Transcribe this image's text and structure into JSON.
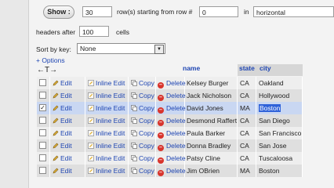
{
  "controls": {
    "show_label": "Show :",
    "rows_value": "30",
    "rows_text": "row(s) starting from row #",
    "start_value": "0",
    "in_text": "in",
    "mode_value": "horizontal",
    "headers_after_label": "headers after",
    "headers_after_value": "100",
    "cells_label": "cells",
    "sort_label": "Sort by key:",
    "sort_value": "None",
    "options_link": "+ Options",
    "arrows": "←T→"
  },
  "table": {
    "headers": {
      "name": "name",
      "state": "state",
      "city": "city"
    },
    "actions": {
      "edit": "Edit",
      "inline_edit": "Inline Edit",
      "copy": "Copy",
      "delete": "Delete"
    },
    "rows": [
      {
        "name": "Kelsey Burger",
        "state": "CA",
        "city": "Oakland",
        "checked": false
      },
      {
        "name": "Jack Nicholson",
        "state": "CA",
        "city": "Hollywood",
        "checked": false
      },
      {
        "name": "David Jones",
        "state": "MA",
        "city": "Boston",
        "checked": true
      },
      {
        "name": "Desmond Rafferty",
        "state": "CA",
        "city": "San Diego",
        "checked": false
      },
      {
        "name": "Paula Barker",
        "state": "CA",
        "city": "San Francisco",
        "checked": false
      },
      {
        "name": "Donna Bradley",
        "state": "CA",
        "city": "San Jose",
        "checked": false
      },
      {
        "name": "Patsy Cline",
        "state": "CA",
        "city": "Tuscaloosa",
        "checked": false
      },
      {
        "name": "Jim OBrien",
        "state": "MA",
        "city": "Boston",
        "checked": false
      }
    ]
  },
  "colors": {
    "link": "#1f46b3",
    "selected_row": "#c9d7f2",
    "highlight": "#2f62d9",
    "delete": "#d8342c"
  }
}
